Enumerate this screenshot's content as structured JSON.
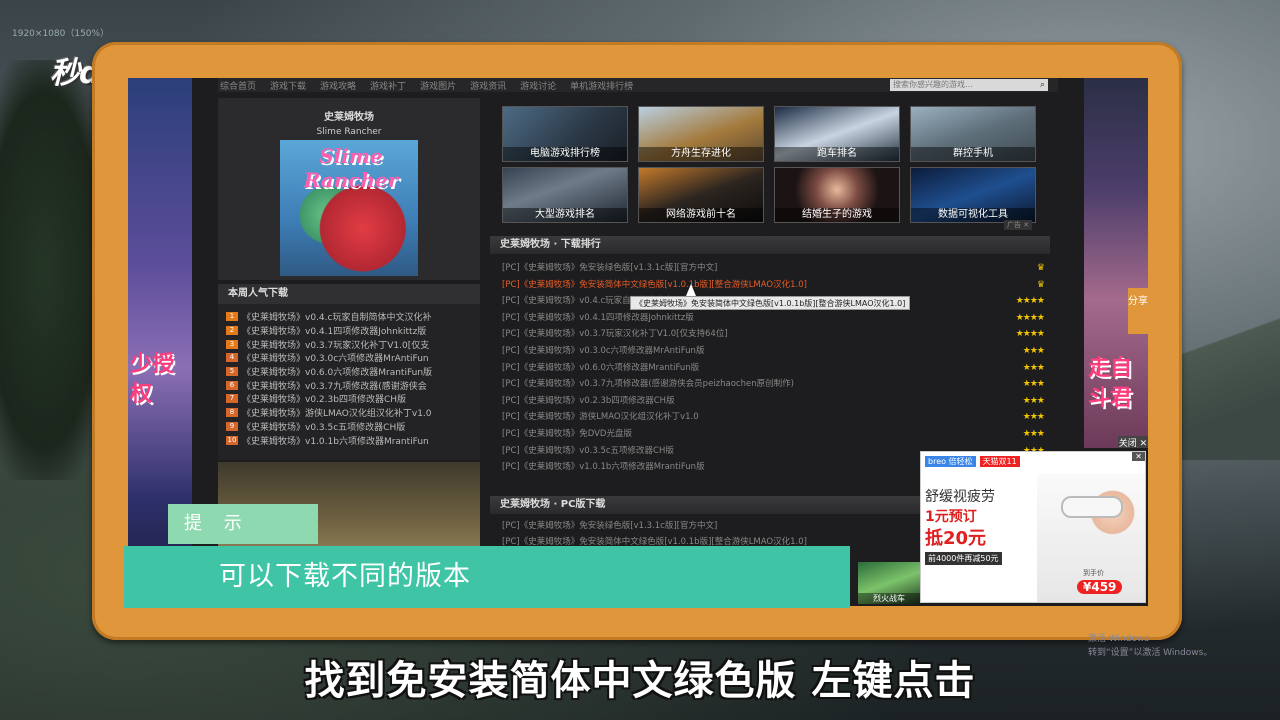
{
  "top_info": "1920×1080（150%）",
  "logo": "秒dong视频",
  "nav": {
    "items": [
      "综合首页",
      "游戏下载",
      "游戏攻略",
      "游戏补丁",
      "游戏图片",
      "游戏资讯",
      "游戏讨论",
      "单机游戏排行榜"
    ],
    "search_placeholder": "搜索你感兴趣的游戏…"
  },
  "game": {
    "title_cn": "史莱姆牧场",
    "title_en": "Slime Rancher",
    "cover_text": "Slime Rancher"
  },
  "weekly": {
    "title": "本周人气下载",
    "items": [
      "《史莱姆牧场》v0.4.c玩家自制简体中文汉化补",
      "《史莱姆牧场》v0.4.1四项修改器Johnkittz版",
      "《史莱姆牧场》v0.3.7玩家汉化补丁V1.0[仅支",
      "《史莱姆牧场》v0.3.0c六项修改器MrAntiFun",
      "《史莱姆牧场》v0.6.0六项修改器MrantiFun版",
      "《史莱姆牧场》v0.3.7九项修改器(感谢游侠会",
      "《史莱姆牧场》v0.2.3b四项修改器CH版",
      "《史莱姆牧场》游侠LMAO汉化组汉化补丁v1.0",
      "《史莱姆牧场》v0.3.5c五项修改器CH版",
      "《史莱姆牧场》v1.0.1b六项修改器MrantiFun"
    ]
  },
  "thumbs": [
    "电脑游戏排行榜",
    "方舟生存进化",
    "跑车排名",
    "群控手机",
    "大型游戏排名",
    "网络游戏前十名",
    "结婚生子的游戏",
    "数据可视化工具"
  ],
  "ad_tag": "广告 ✕",
  "rank": {
    "title": "史莱姆牧场 · 下载排行",
    "items": [
      {
        "text": "[PC]《史莱姆牧场》免安装绿色版[v1.3.1c版][官方中文]",
        "stars": "♛"
      },
      {
        "text": "[PC]《史莱姆牧场》免安装简体中文绿色版[v1.0.1b版][整合游侠LMAO汉化1.0]",
        "stars": "♛"
      },
      {
        "text": "[PC]《史莱姆牧场》v0.4.c玩家自制简体中文汉化补丁",
        "stars": "★★★★"
      },
      {
        "text": "[PC]《史莱姆牧场》v0.4.1四项修改器Johnkittz版",
        "stars": "★★★★"
      },
      {
        "text": "[PC]《史莱姆牧场》v0.3.7玩家汉化补丁V1.0[仅支持64位]",
        "stars": "★★★★"
      },
      {
        "text": "[PC]《史莱姆牧场》v0.3.0c六项修改器MrAntiFun版",
        "stars": "★★★"
      },
      {
        "text": "[PC]《史莱姆牧场》v0.6.0六项修改器MrantiFun版",
        "stars": "★★★"
      },
      {
        "text": "[PC]《史莱姆牧场》v0.3.7九项修改器(感谢游侠会员peizhaochen原创制作)",
        "stars": "★★★"
      },
      {
        "text": "[PC]《史莱姆牧场》v0.2.3b四项修改器CH版",
        "stars": "★★★"
      },
      {
        "text": "[PC]《史莱姆牧场》游侠LMAO汉化组汉化补丁v1.0",
        "stars": "★★★"
      },
      {
        "text": "[PC]《史莱姆牧场》免DVD光盘版",
        "stars": "★★★"
      },
      {
        "text": "[PC]《史莱姆牧场》v0.3.5c五项修改器CH版",
        "stars": "★★★"
      },
      {
        "text": "[PC]《史莱姆牧场》v1.0.1b六项修改器MrantiFun版",
        "stars": "★★★"
      }
    ],
    "tooltip": "《史莱姆牧场》免安装简体中文绿色版[v1.0.1b版][整合游侠LMAO汉化1.0]"
  },
  "pc": {
    "title": "史莱姆牧场 · PC版下载",
    "items": [
      "[PC]《史莱姆牧场》免安装绿色版[v1.3.1c版][官方中文]",
      "[PC]《史莱姆牧场》免安装简体中文绿色版[v1.0.1b版][整合游侠LMAO汉化1.0]"
    ],
    "mini_thumb": "烈火战车"
  },
  "side_left_text": "少授权",
  "side_right_text": "走自斗君",
  "side_right_share": "分享",
  "side_right_close": "关闭 ✕",
  "ad": {
    "brand1": "breo 倍轻松",
    "brand2": "天猫双11",
    "headline": "舒缓视疲劳",
    "line1": "1元预订",
    "line2": "抵20元",
    "line3": "前4000件再减50元",
    "price_label": "到手价",
    "price": "¥459",
    "close": "✕"
  },
  "hint": {
    "label": "提 示",
    "text": "可以下载不同的版本"
  },
  "subtitle": "找到免安装简体中文绿色版 左键点击",
  "watermark": {
    "line1": "激活 Windows",
    "line2": "转到“设置”以激活 Windows。"
  },
  "colors": {
    "frame": "#e0963a",
    "hint_bar": "#3fc4a6",
    "hint_label": "#8fd9b0",
    "highlight_row": "#e85c26",
    "stars": "#f0c400"
  }
}
